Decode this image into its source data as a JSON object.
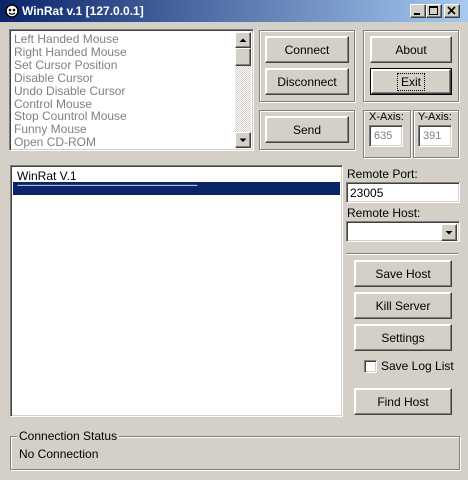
{
  "window": {
    "title": "WinRat v.1 [127.0.0.1]",
    "controls": [
      "minimize",
      "maximize",
      "close"
    ]
  },
  "commands": [
    "Left Handed Mouse",
    "Right Handed Mouse",
    "Set Cursor Position",
    "Disable Cursor",
    "Undo Disable Cursor",
    "Control Mouse",
    "Stop Countrol Mouse",
    "Funny Mouse",
    "Open CD-ROM"
  ],
  "buttons": {
    "connect": "Connect",
    "disconnect": "Disconnect",
    "about": "About",
    "exit": "Exit",
    "send": "Send",
    "save_host": "Save Host",
    "kill_server": "Kill Server",
    "settings": "Settings",
    "find_host": "Find Host"
  },
  "axis": {
    "x_label": "X-Axis:",
    "x_value": "635",
    "y_label": "Y-Axis:",
    "y_value": "391"
  },
  "log": {
    "lines": [
      "WinRat  V.1",
      "------------------------------------------------------------------------------------------"
    ]
  },
  "remote": {
    "port_label": "Remote Port:",
    "port_value": "23005",
    "host_label": "Remote Host:",
    "host_value": ""
  },
  "save_log": {
    "label": "Save Log List",
    "checked": false
  },
  "status": {
    "caption": "Connection Status",
    "text": "No Connection"
  },
  "colors": {
    "titlebar_start": "#0a246a",
    "titlebar_end": "#a6caf0",
    "selection": "#0a246a",
    "face": "#d4d0c8"
  }
}
